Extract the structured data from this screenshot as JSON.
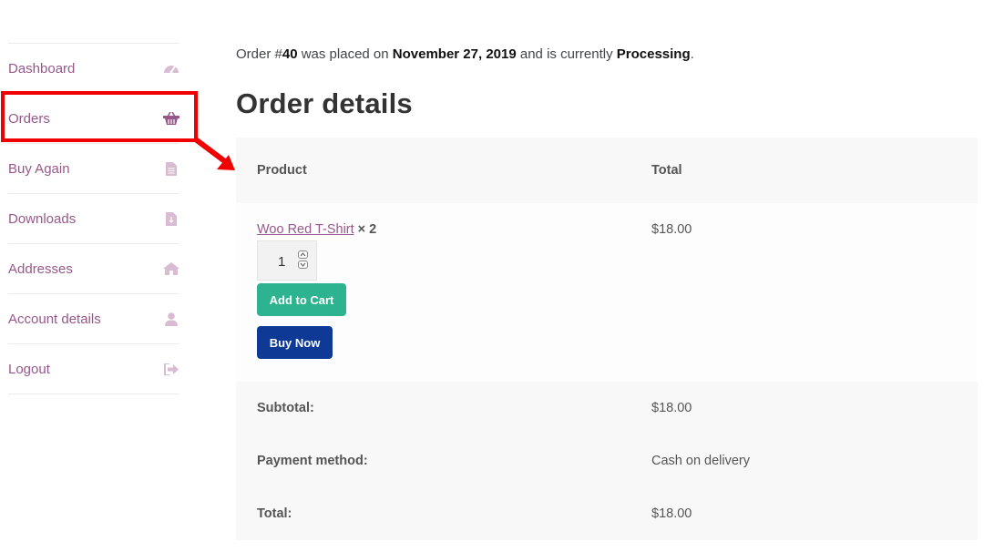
{
  "sidebar": {
    "items": [
      {
        "label": "Dashboard",
        "icon": "dashboard-icon"
      },
      {
        "label": "Orders",
        "icon": "basket-icon"
      },
      {
        "label": "Buy Again",
        "icon": "file-icon"
      },
      {
        "label": "Downloads",
        "icon": "file-download-icon"
      },
      {
        "label": "Addresses",
        "icon": "home-icon"
      },
      {
        "label": "Account details",
        "icon": "user-icon"
      },
      {
        "label": "Logout",
        "icon": "sign-out-icon"
      }
    ]
  },
  "order": {
    "prefix": "Order #",
    "number": "40",
    "mid": " was placed on ",
    "date": "November 27, 2019",
    "mid2": " and is currently ",
    "status": "Processing",
    "suffix": "."
  },
  "title": "Order details",
  "table": {
    "col_product": "Product",
    "col_total": "Total",
    "item": {
      "name": "Woo Red T-Shirt",
      "qty_text": " × 2",
      "price": "$18.00",
      "qty_input": "1",
      "add_to_cart": "Add to Cart",
      "buy_now": "Buy Now"
    },
    "subtotal_label": "Subtotal:",
    "subtotal_value": "$18.00",
    "payment_label": "Payment method:",
    "payment_value": "Cash on delivery",
    "total_label": "Total:",
    "total_value": "$18.00"
  },
  "colors": {
    "link": "#96588a",
    "highlight": "#f00000",
    "add_to_cart": "#2db38f",
    "buy_now": "#0e3a96"
  }
}
